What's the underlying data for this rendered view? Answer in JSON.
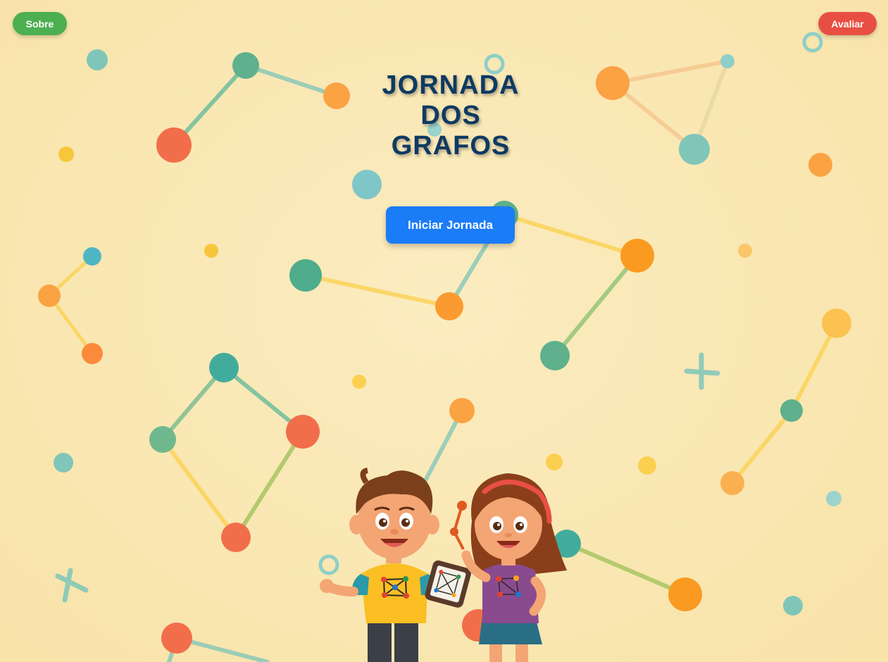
{
  "header": {
    "about_label": "Sobre",
    "rate_label": "Avaliar"
  },
  "hero": {
    "title_lines": [
      "JORNADA",
      "DOS",
      "GRAFOS"
    ],
    "start_label": "Iniciar Jornada"
  },
  "colors": {
    "background": "#f9e7b3",
    "about_button": "#4caf50",
    "rate_button": "#e84f42",
    "start_button": "#1b7cf7",
    "title": "#0e3a63"
  },
  "illustration": {
    "name": "two-kids-with-graph-tablet"
  }
}
